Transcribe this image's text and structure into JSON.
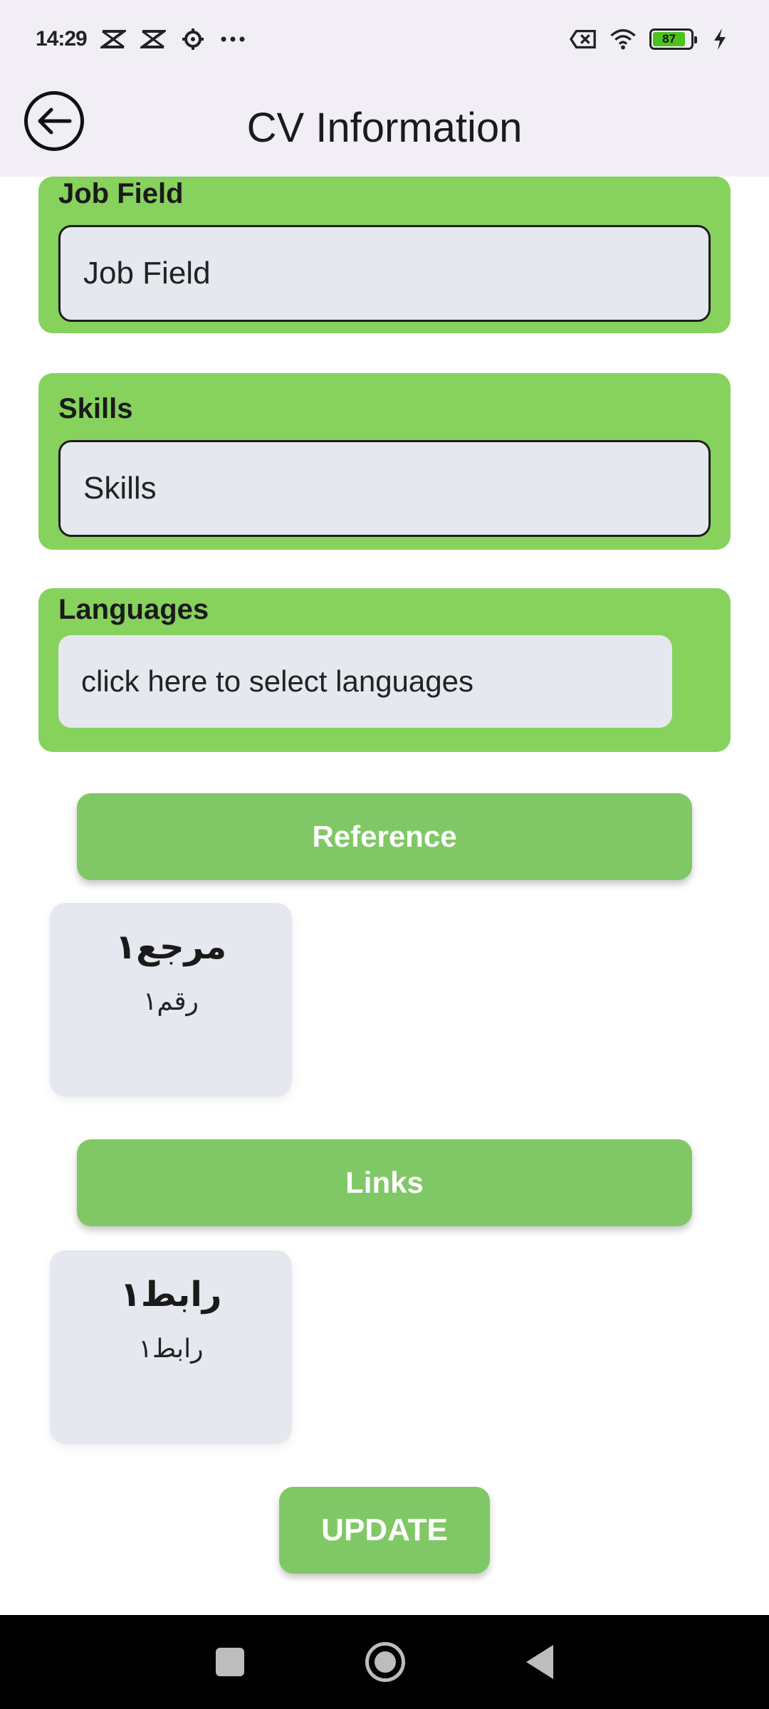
{
  "status_bar": {
    "time": "14:29",
    "battery_level": "87",
    "icons": [
      "capcut-icon",
      "capcut-icon",
      "gear-icon",
      "more-dots-icon",
      "sim-off-icon",
      "wifi-icon",
      "battery-icon",
      "charging-icon"
    ]
  },
  "app_bar": {
    "title": "CV Information",
    "back_icon": "back-arrow-icon"
  },
  "fields": {
    "job_field": {
      "label": "Job Field",
      "placeholder": "Job Field"
    },
    "skills": {
      "label": "Skills",
      "placeholder": "Skills"
    },
    "languages": {
      "label": "Languages",
      "placeholder": "click here to select languages"
    }
  },
  "reference": {
    "button_label": "Reference",
    "items": [
      {
        "title": "مرجع١",
        "subtitle": "رقم١"
      }
    ]
  },
  "links": {
    "button_label": "Links",
    "items": [
      {
        "title": "رابط١",
        "subtitle": "رابط١"
      }
    ]
  },
  "update_label": "UPDATE",
  "colors": {
    "card_green": "#87d15d",
    "button_green": "#80c865",
    "input_bg": "#e5e8ee",
    "app_bar_bg": "#f1eff5"
  }
}
